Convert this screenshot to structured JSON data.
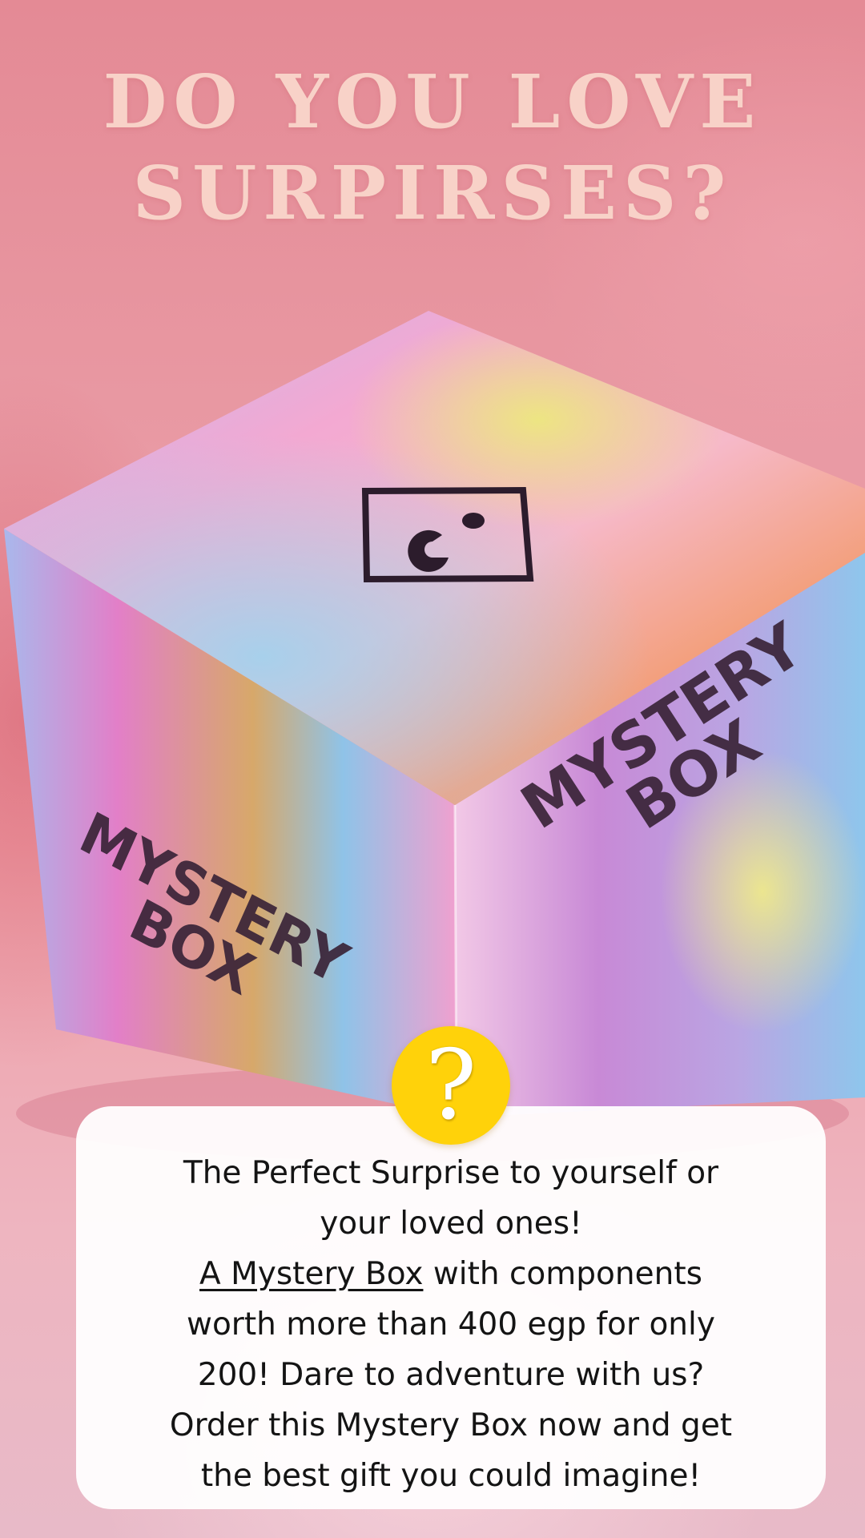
{
  "headline": {
    "line1": "DO YOU LOVE",
    "line2": "SURPIRSES?"
  },
  "product_image": {
    "box_label_left": "MYSTERY BOX",
    "box_label_right": "MYSTERY BOX",
    "logo_icon": "brand-logo-square-icon"
  },
  "badge": {
    "icon": "question-mark-icon",
    "symbol": "?",
    "color": "#ffd20a"
  },
  "card": {
    "intro": "The Perfect Surprise to yourself or your loved ones!",
    "link_text": "A Mystery Box",
    "body": " with components worth more than 400 egp for only 200!  Dare to adventure with us? Order this Mystery Box now and get the best gift you could imagine!"
  },
  "colors": {
    "background": "#e99aa4",
    "headline": "#f8d2c8",
    "card": "#ffffff",
    "badge": "#ffd20a",
    "text": "#141414"
  }
}
